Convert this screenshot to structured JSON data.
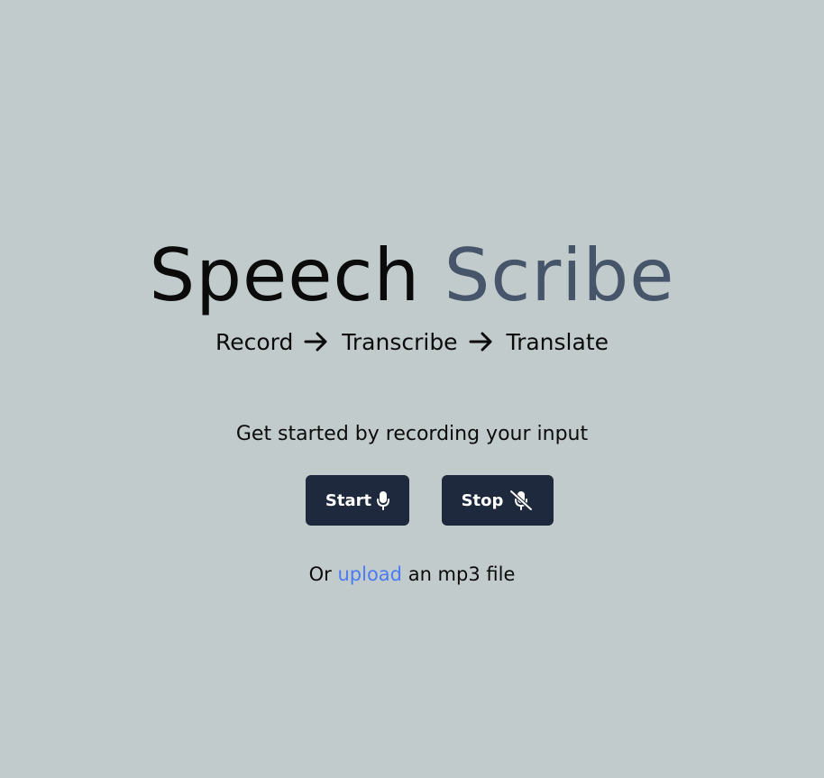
{
  "header": {
    "title_word1": "Speech",
    "title_word2": "Scribe",
    "tagline": {
      "step1": "Record",
      "step2": "Transcribe",
      "step3": "Translate"
    }
  },
  "main": {
    "prompt": "Get started by recording your input",
    "start_button": {
      "label": "Start",
      "icon": "microphone-icon"
    },
    "stop_button": {
      "label": "Stop",
      "icon": "microphone-slash-icon"
    },
    "upload": {
      "prefix": "Or",
      "link_label": "upload",
      "suffix": "an mp3 file"
    }
  },
  "colors": {
    "background": "#c2cbcc",
    "title_accent": "#465569",
    "button_bg": "#1e293d",
    "link": "#4a7bf0"
  }
}
